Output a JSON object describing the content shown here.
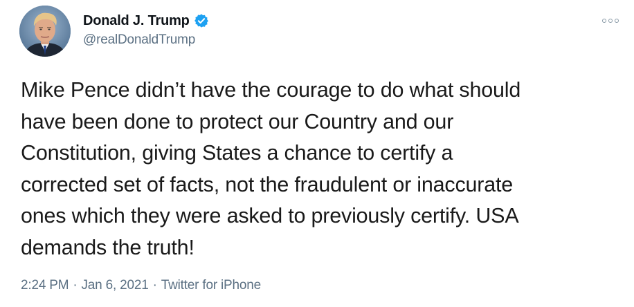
{
  "author": {
    "display_name": "Donald J. Trump",
    "handle": "@realDonaldTrump",
    "verified": true,
    "avatar_icon": "profile-photo",
    "verified_icon": "verified-badge-icon",
    "verified_color": "#1da1f2"
  },
  "tweet": {
    "text": "Mike Pence didn’t have the courage to do what should\nhave been done to protect our Country and our\nConstitution, giving States a chance to certify a\ncorrected set of facts, not the fraudulent or inaccurate\nones which they were asked to previously certify. USA\ndemands the truth!"
  },
  "meta": {
    "time": "2:24 PM",
    "date": "Jan 6, 2021",
    "source": "Twitter for iPhone",
    "separator": "·"
  },
  "more_icon": "more-options-icon"
}
